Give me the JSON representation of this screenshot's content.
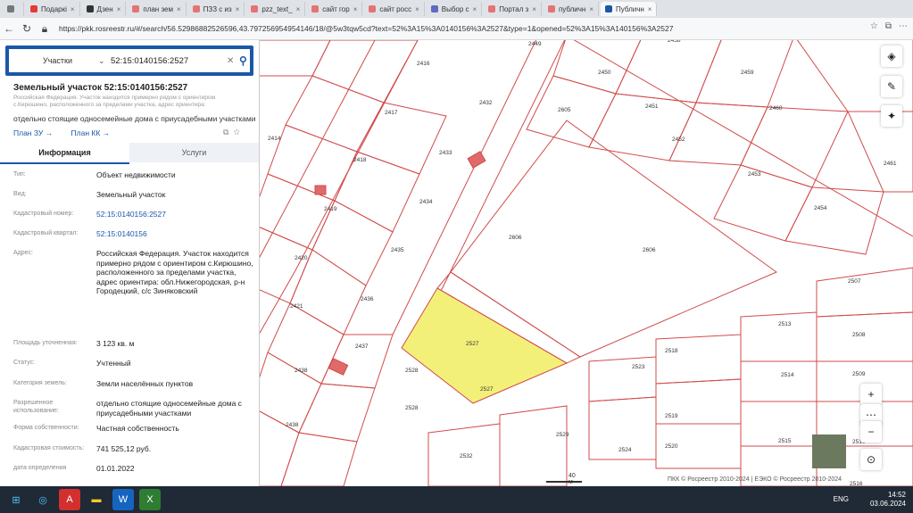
{
  "browser": {
    "tabs": [
      {
        "label": "",
        "color": "#777"
      },
      {
        "label": "Подаркі",
        "color": "#e53935"
      },
      {
        "label": "Дзен",
        "color": "#333333"
      },
      {
        "label": "план зем",
        "color": "#e57373"
      },
      {
        "label": "ПЗЗ с из",
        "color": "#e57373"
      },
      {
        "label": "pzz_text_",
        "color": "#e57373"
      },
      {
        "label": "сайт гор",
        "color": "#e57373"
      },
      {
        "label": "сайт росс",
        "color": "#e57373"
      },
      {
        "label": "Выбор с",
        "color": "#5c6bc0"
      },
      {
        "label": "Портал з",
        "color": "#e57373"
      },
      {
        "label": "публичн",
        "color": "#e57373"
      },
      {
        "label": "Публичн",
        "color": "#1a57a9",
        "active": true
      }
    ],
    "url": "https://pkk.rosreestr.ru/#/search/56.52986882526596,43.797256954954146/18/@5w3tqw5cd?text=52%3A15%3A0140156%3A2527&type=1&opened=52%3A15%3A140156%3A2527"
  },
  "search": {
    "type_label": "Участки",
    "value": "52:15:0140156:2527"
  },
  "parcel": {
    "title": "Земельный участок 52:15:0140156:2527",
    "address_short": "Российская Федерация. Участок находится примерно рядом с ориентиром с.Кирюшино, расположенного за пределами участка, адрес ориентира:",
    "use": "отдельно стоящие односемейные дома с приусадебными участками",
    "link_zu": "План ЗУ →",
    "link_kk": "План КК →"
  },
  "tabs": {
    "info": "Информация",
    "services": "Услуги"
  },
  "info_rows": [
    {
      "label": "Тип:",
      "value": "Объект недвижимости",
      "link": false
    },
    {
      "label": "Вид:",
      "value": "Земельный участок",
      "link": false
    },
    {
      "label": "Кадастровый номер:",
      "value": "52:15:0140156:2527",
      "link": true
    },
    {
      "label": "Кадастровый квартал:",
      "value": "52:15:0140156",
      "link": true
    },
    {
      "label": "Адрес:",
      "value": "Российская Федерация. Участок находится примерно рядом с ориентиром с.Кирюшино, расположенного за пределами участка, адрес ориентира: обл.Нижегородская, р-н Городецкий, с/с Зиняковский",
      "link": false
    },
    {
      "label": "Площадь уточненная:",
      "value": "3 123 кв. м",
      "link": false
    },
    {
      "label": "Статус:",
      "value": "Учтенный",
      "link": false
    },
    {
      "label": "Категория земель:",
      "value": "Земли населённых пунктов",
      "link": false
    },
    {
      "label": "Разрешенное использование:",
      "value": "отдельно стоящие односемейные дома с приусадебными участками",
      "link": false
    },
    {
      "label": "Форма собственности:",
      "value": "Частная собственность",
      "link": false
    },
    {
      "label": "Кадастровая стоимость:",
      "value": "741 525,12 руб.",
      "link": false
    },
    {
      "label": "дата определения",
      "value": "01.01.2022",
      "link": false
    }
  ],
  "map": {
    "parcel_labels": [
      "2449",
      "2458",
      "2416",
      "2450",
      "2459",
      "2432",
      "2417",
      "2605",
      "2451",
      "2460",
      "2414",
      "2433",
      "2452",
      "2461",
      "2418",
      "2453",
      "2419",
      "2434",
      "2454",
      "2606",
      "2606",
      "2420",
      "2435",
      "2507",
      "2421",
      "2436",
      "2513",
      "2508",
      "2527",
      "2437",
      "2518",
      "2438",
      "2528",
      "2523",
      "2514",
      "2509",
      "2527",
      "2528",
      "2510",
      "2438",
      "2529",
      "2519",
      "2524",
      "2520",
      "2515",
      "2532",
      "2516"
    ],
    "scale": "40 м",
    "copyright": "ПКК © Росреестр 2010-2024 | ЕЭКО © Росреестр 2010-2024",
    "highlight_color": "#f3f07a"
  },
  "taskbar": {
    "lang": "ENG",
    "time": "14:52",
    "date": "03.06.2024"
  }
}
